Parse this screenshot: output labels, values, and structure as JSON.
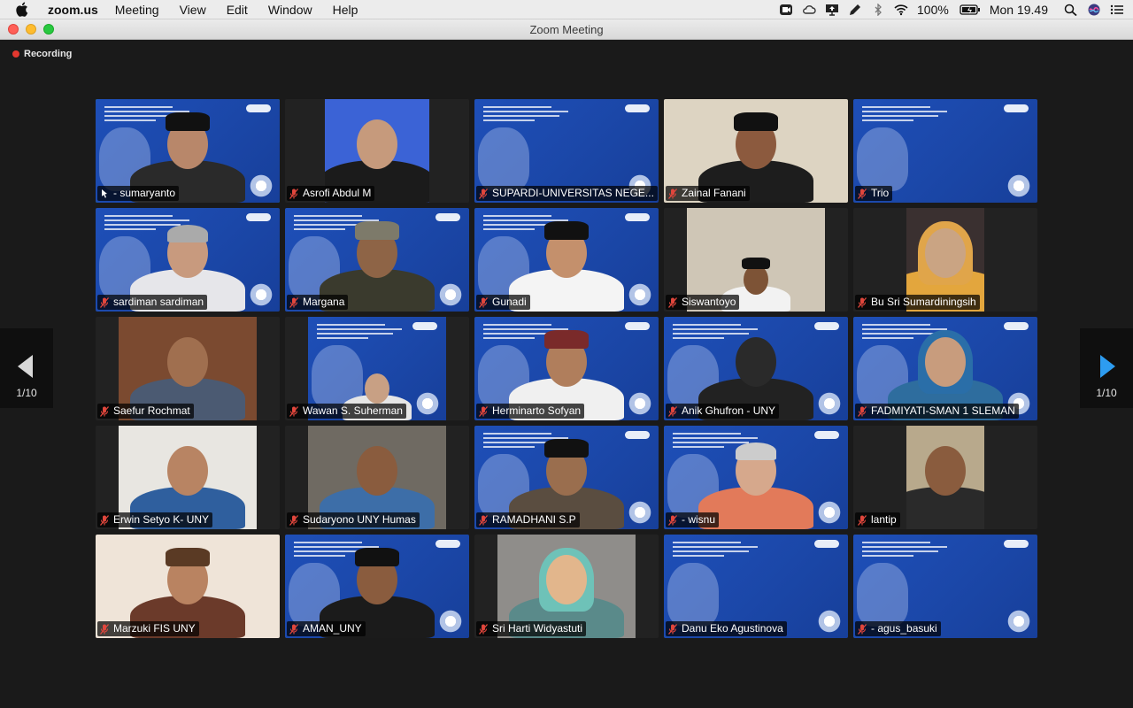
{
  "menubar": {
    "app": "zoom.us",
    "items": [
      "Meeting",
      "View",
      "Edit",
      "Window",
      "Help"
    ],
    "battery": "100%",
    "clock": "Mon 19.49"
  },
  "window": {
    "title": "Zoom Meeting"
  },
  "recording": {
    "label": "Recording"
  },
  "pager": {
    "left": "1/10",
    "right": "1/10"
  },
  "colors": {
    "active_speaker": "#23d953",
    "slide_blue": "#1e4fb8",
    "mic_muted": "#e0463c",
    "recording": "#e3382f"
  },
  "participants": [
    {
      "name": "- sumaryanto",
      "muted": false,
      "active": true
    },
    {
      "name": "Asrofi Abdul M",
      "muted": true
    },
    {
      "name": "SUPARDI-UNIVERSITAS NEGE...",
      "muted": true
    },
    {
      "name": "Zainal Fanani",
      "muted": true
    },
    {
      "name": "Trio",
      "muted": true
    },
    {
      "name": "sardiman sardiman",
      "muted": true
    },
    {
      "name": "Margana",
      "muted": true
    },
    {
      "name": "Gunadi",
      "muted": true
    },
    {
      "name": "Siswantoyo",
      "muted": true
    },
    {
      "name": "Bu Sri Sumardiningsih",
      "muted": true
    },
    {
      "name": "Saefur Rochmat",
      "muted": true
    },
    {
      "name": "Wawan S. Suherman",
      "muted": true
    },
    {
      "name": "Herminarto Sofyan",
      "muted": true
    },
    {
      "name": "Anik Ghufron - UNY",
      "muted": true
    },
    {
      "name": "FADMIYATI-SMAN 1 SLEMAN",
      "muted": true
    },
    {
      "name": "Erwin Setyo K- UNY",
      "muted": true
    },
    {
      "name": "Sudaryono UNY Humas",
      "muted": true
    },
    {
      "name": "RAMADHANI S.P",
      "muted": true
    },
    {
      "name": "- wisnu",
      "muted": true
    },
    {
      "name": "lantip",
      "muted": true
    },
    {
      "name": "Marzuki FIS UNY",
      "muted": true
    },
    {
      "name": "AMAN_UNY",
      "muted": true
    },
    {
      "name": "Sri Harti Widyastuti",
      "muted": true
    },
    {
      "name": "Danu Eko Agustinova",
      "muted": true
    },
    {
      "name": "- agus_basuki",
      "muted": true
    }
  ]
}
